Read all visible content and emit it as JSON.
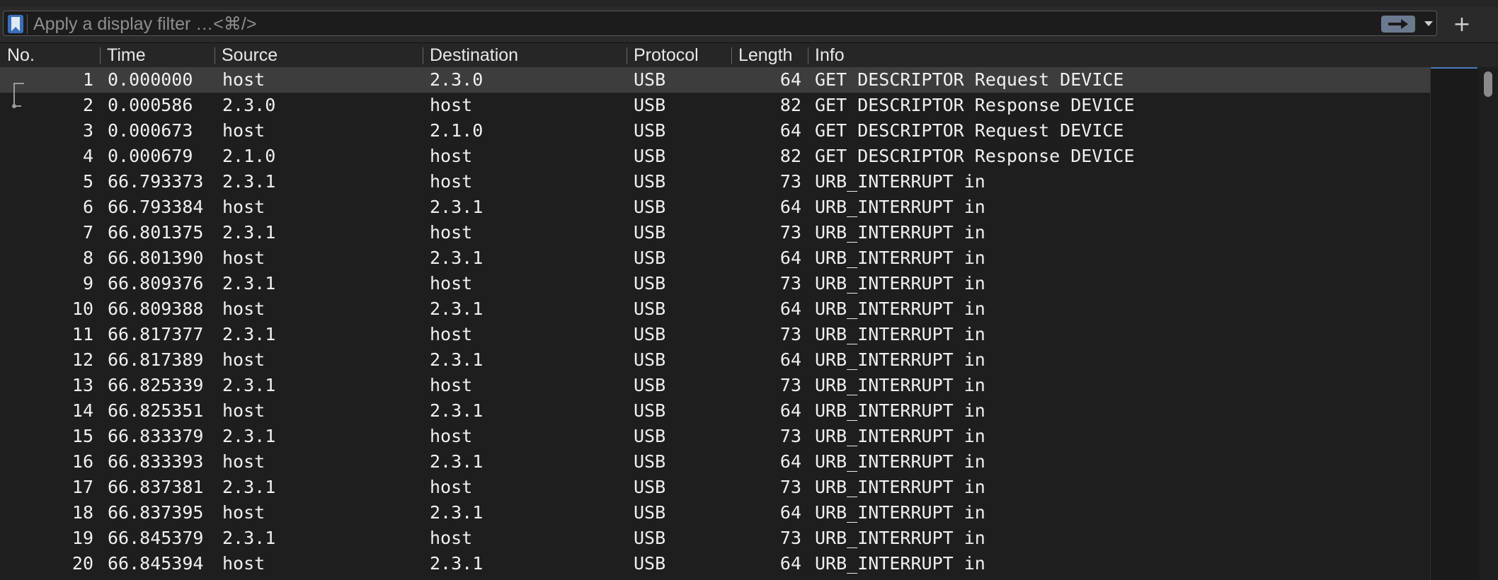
{
  "filter": {
    "placeholder": "Apply a display filter …<⌘/>",
    "icons": {
      "bookmark": "bookmark-icon",
      "apply": "arrow-right-icon",
      "dropdown": "chevron-down-icon",
      "add": "plus-icon"
    },
    "add_label": "+"
  },
  "columns": {
    "no": "No.",
    "time": "Time",
    "source": "Source",
    "destination": "Destination",
    "protocol": "Protocol",
    "length": "Length",
    "info": "Info"
  },
  "selected_row": 0,
  "packets": [
    {
      "no": "1",
      "time": "0.000000",
      "source": "host",
      "destination": "2.3.0",
      "protocol": "USB",
      "length": "64",
      "info": "GET DESCRIPTOR Request DEVICE"
    },
    {
      "no": "2",
      "time": "0.000586",
      "source": "2.3.0",
      "destination": "host",
      "protocol": "USB",
      "length": "82",
      "info": "GET DESCRIPTOR Response DEVICE"
    },
    {
      "no": "3",
      "time": "0.000673",
      "source": "host",
      "destination": "2.1.0",
      "protocol": "USB",
      "length": "64",
      "info": "GET DESCRIPTOR Request DEVICE"
    },
    {
      "no": "4",
      "time": "0.000679",
      "source": "2.1.0",
      "destination": "host",
      "protocol": "USB",
      "length": "82",
      "info": "GET DESCRIPTOR Response DEVICE"
    },
    {
      "no": "5",
      "time": "66.793373",
      "source": "2.3.1",
      "destination": "host",
      "protocol": "USB",
      "length": "73",
      "info": "URB_INTERRUPT in"
    },
    {
      "no": "6",
      "time": "66.793384",
      "source": "host",
      "destination": "2.3.1",
      "protocol": "USB",
      "length": "64",
      "info": "URB_INTERRUPT in"
    },
    {
      "no": "7",
      "time": "66.801375",
      "source": "2.3.1",
      "destination": "host",
      "protocol": "USB",
      "length": "73",
      "info": "URB_INTERRUPT in"
    },
    {
      "no": "8",
      "time": "66.801390",
      "source": "host",
      "destination": "2.3.1",
      "protocol": "USB",
      "length": "64",
      "info": "URB_INTERRUPT in"
    },
    {
      "no": "9",
      "time": "66.809376",
      "source": "2.3.1",
      "destination": "host",
      "protocol": "USB",
      "length": "73",
      "info": "URB_INTERRUPT in"
    },
    {
      "no": "10",
      "time": "66.809388",
      "source": "host",
      "destination": "2.3.1",
      "protocol": "USB",
      "length": "64",
      "info": "URB_INTERRUPT in"
    },
    {
      "no": "11",
      "time": "66.817377",
      "source": "2.3.1",
      "destination": "host",
      "protocol": "USB",
      "length": "73",
      "info": "URB_INTERRUPT in"
    },
    {
      "no": "12",
      "time": "66.817389",
      "source": "host",
      "destination": "2.3.1",
      "protocol": "USB",
      "length": "64",
      "info": "URB_INTERRUPT in"
    },
    {
      "no": "13",
      "time": "66.825339",
      "source": "2.3.1",
      "destination": "host",
      "protocol": "USB",
      "length": "73",
      "info": "URB_INTERRUPT in"
    },
    {
      "no": "14",
      "time": "66.825351",
      "source": "host",
      "destination": "2.3.1",
      "protocol": "USB",
      "length": "64",
      "info": "URB_INTERRUPT in"
    },
    {
      "no": "15",
      "time": "66.833379",
      "source": "2.3.1",
      "destination": "host",
      "protocol": "USB",
      "length": "73",
      "info": "URB_INTERRUPT in"
    },
    {
      "no": "16",
      "time": "66.833393",
      "source": "host",
      "destination": "2.3.1",
      "protocol": "USB",
      "length": "64",
      "info": "URB_INTERRUPT in"
    },
    {
      "no": "17",
      "time": "66.837381",
      "source": "2.3.1",
      "destination": "host",
      "protocol": "USB",
      "length": "73",
      "info": "URB_INTERRUPT in"
    },
    {
      "no": "18",
      "time": "66.837395",
      "source": "host",
      "destination": "2.3.1",
      "protocol": "USB",
      "length": "64",
      "info": "URB_INTERRUPT in"
    },
    {
      "no": "19",
      "time": "66.845379",
      "source": "2.3.1",
      "destination": "host",
      "protocol": "USB",
      "length": "73",
      "info": "URB_INTERRUPT in"
    },
    {
      "no": "20",
      "time": "66.845394",
      "source": "host",
      "destination": "2.3.1",
      "protocol": "USB",
      "length": "64",
      "info": "URB_INTERRUPT in"
    }
  ],
  "colors": {
    "background": "#1e1e1e",
    "selected_row": "#3d3d3d",
    "accent": "#3a6fb8"
  }
}
